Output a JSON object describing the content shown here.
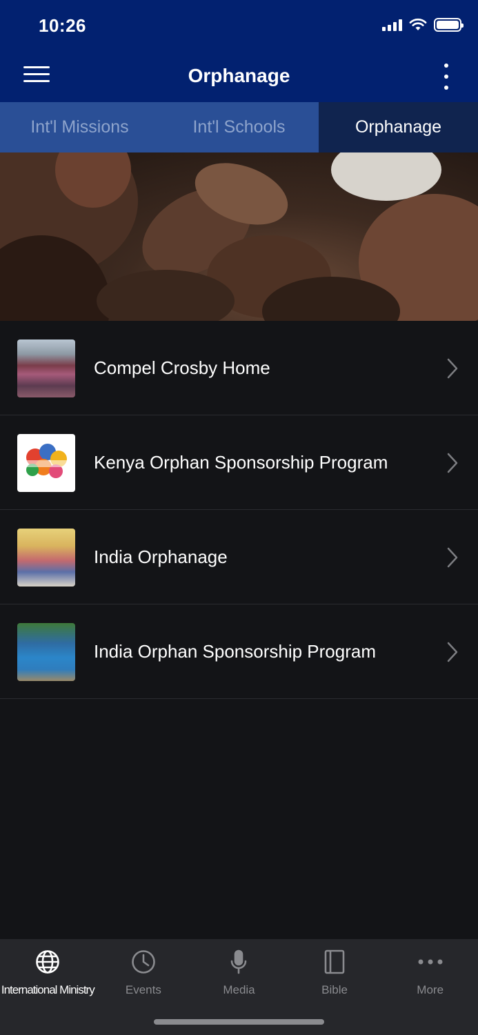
{
  "status_bar": {
    "time": "10:26"
  },
  "header": {
    "title": "Orphanage"
  },
  "tabs": [
    {
      "label": "Int'l Missions",
      "active": false
    },
    {
      "label": "Int'l Schools",
      "active": false
    },
    {
      "label": "Orphanage",
      "active": true
    }
  ],
  "list": {
    "items": [
      {
        "label": "Compel Crosby Home",
        "icon": "chevron-right-icon"
      },
      {
        "label": "Kenya Orphan Sponsorship Program",
        "icon": "chevron-right-icon"
      },
      {
        "label": "India Orphanage",
        "icon": "chevron-right-icon"
      },
      {
        "label": "India Orphan Sponsorship Program",
        "icon": "chevron-right-icon"
      }
    ]
  },
  "tabbar": {
    "items": [
      {
        "label": "International Ministry",
        "icon": "globe-icon",
        "active": true
      },
      {
        "label": "Events",
        "icon": "clock-icon",
        "active": false
      },
      {
        "label": "Media",
        "icon": "microphone-icon",
        "active": false
      },
      {
        "label": "Bible",
        "icon": "book-icon",
        "active": false
      },
      {
        "label": "More",
        "icon": "more-dots-icon",
        "active": false
      }
    ]
  },
  "colors": {
    "header_bg": "#022170",
    "tab_bg": "#2a4f96",
    "tab_active_bg": "#10244f",
    "list_bg": "#131417",
    "tabbar_bg": "#26272b"
  }
}
